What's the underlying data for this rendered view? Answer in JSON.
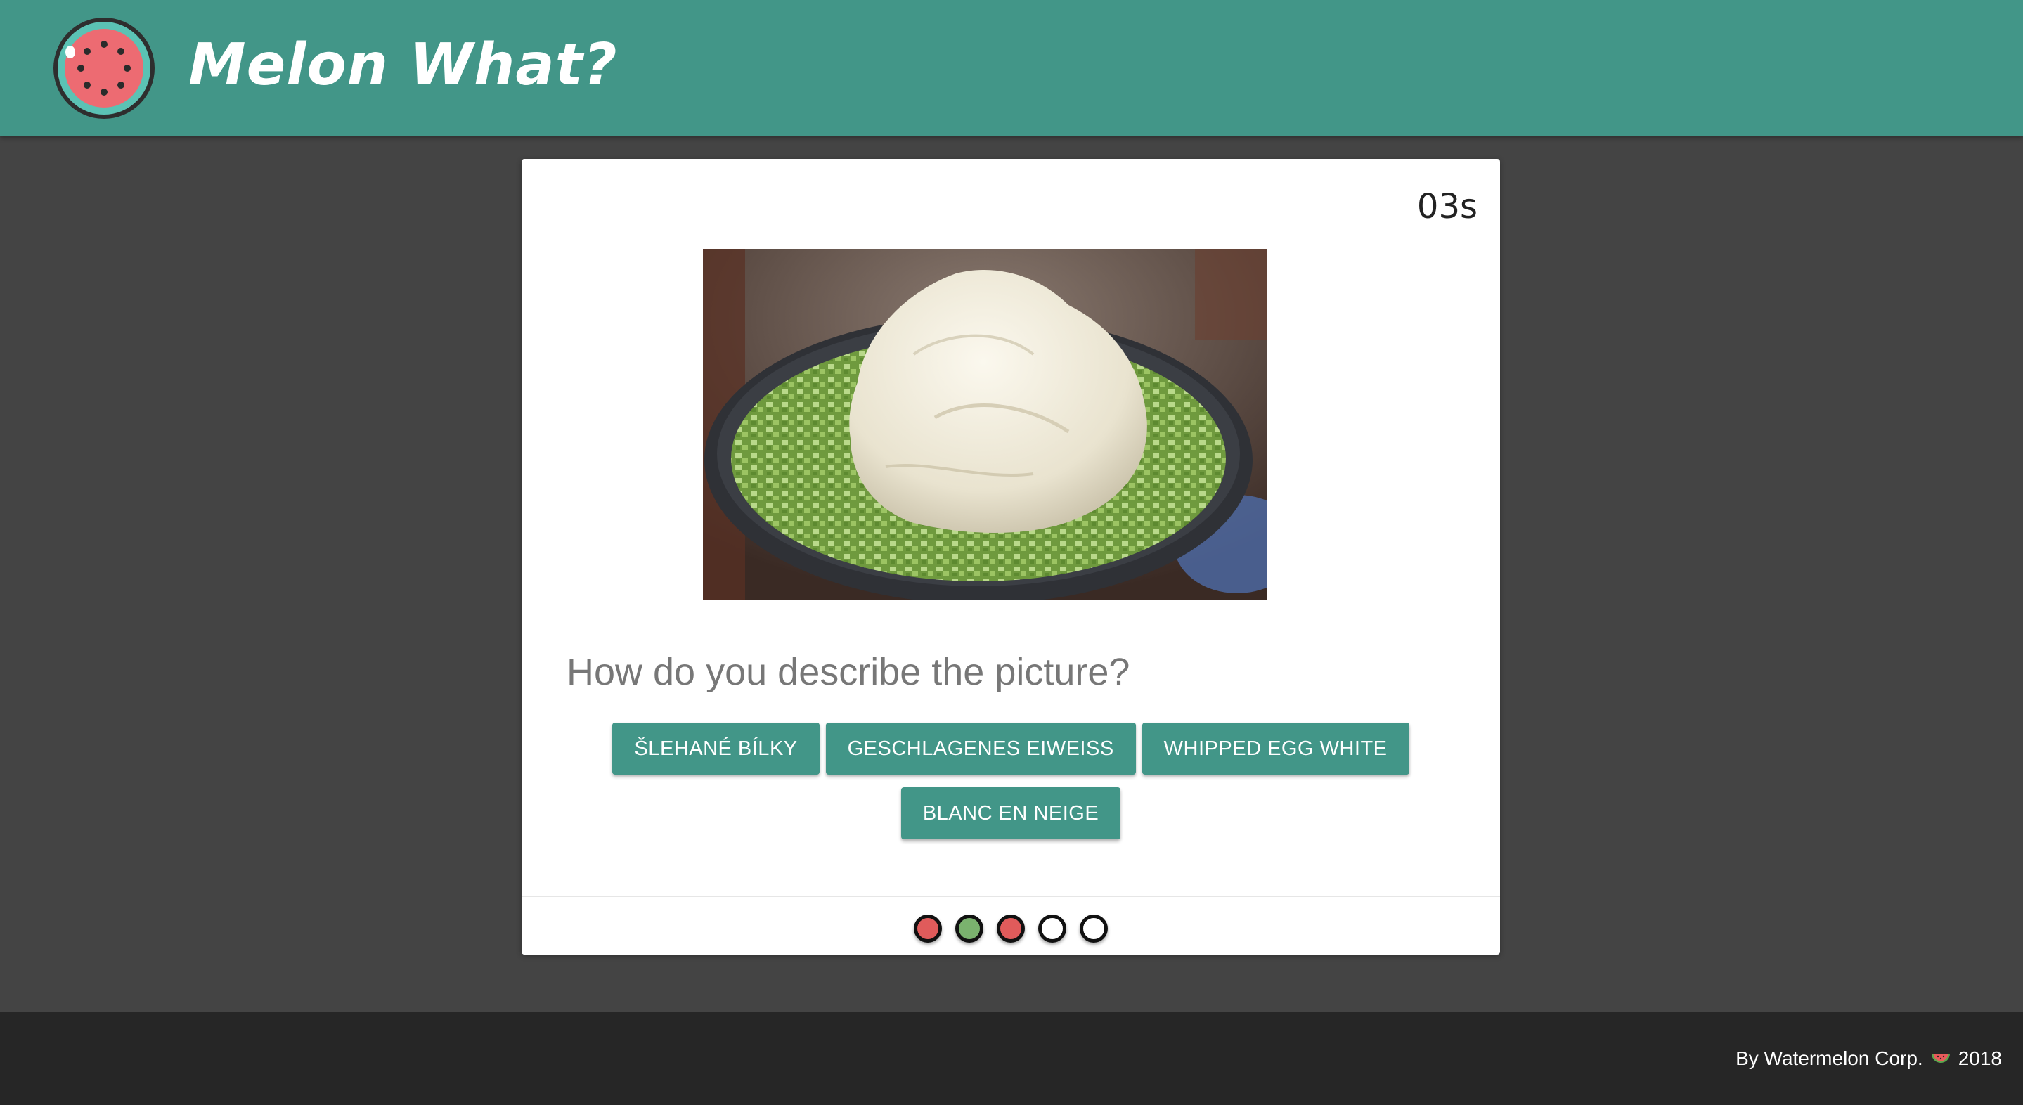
{
  "header": {
    "title": "Melon What?",
    "logo_icon": "watermelon-icon"
  },
  "quiz": {
    "timer": "03s",
    "question": "How do you describe the picture?",
    "answers": [
      "ŠLEHANÉ BÍLKY",
      "GESCHLAGENES EIWEISS",
      "WHIPPED EGG WHITE",
      "BLANC EN NEIGE"
    ],
    "progress": [
      {
        "status": "wrong",
        "color": "#e05b5b"
      },
      {
        "status": "correct",
        "color": "#7ab26e"
      },
      {
        "status": "wrong",
        "color": "#e05b5b"
      },
      {
        "status": "pending",
        "color": "#ffffff"
      },
      {
        "status": "pending",
        "color": "#ffffff"
      }
    ]
  },
  "footer": {
    "by_text": "By Watermelon Corp.",
    "icon": "watermelon-slice-icon",
    "year": "2018"
  },
  "colors": {
    "brand": "#429688",
    "background": "#444444",
    "footer": "#262626"
  }
}
